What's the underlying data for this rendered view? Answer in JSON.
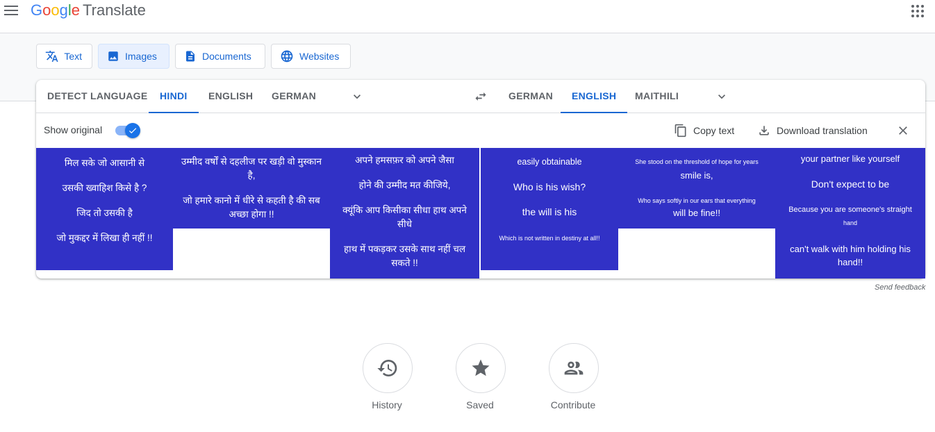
{
  "header": {
    "logo": [
      "G",
      "o",
      "o",
      "g",
      "l",
      "e"
    ],
    "logo_colors": [
      "#4285f4",
      "#ea4335",
      "#fbbc05",
      "#4285f4",
      "#34a853",
      "#ea4335"
    ],
    "product": "Translate"
  },
  "modes": {
    "text": "Text",
    "images": "Images",
    "documents": "Documents",
    "websites": "Websites"
  },
  "source_langs": [
    "DETECT LANGUAGE",
    "HINDI",
    "ENGLISH",
    "GERMAN"
  ],
  "target_langs": [
    "GERMAN",
    "ENGLISH",
    "MAITHILI"
  ],
  "toolbar": {
    "show_original": "Show original",
    "copy_text": "Copy text",
    "download": "Download translation"
  },
  "original": {
    "b1": [
      "मिल सके जो आसानी से",
      "उसकी ख्वाहिश किसे है ?",
      "जिद तो उसकी है",
      "जो मुकद्दर में लिखा ही नहीं !!"
    ],
    "b2": [
      "उम्मीद वर्षों से दहलीज पर खड़ी वो मुस्कान है,",
      "जो हमारे कानो में धीरे से कहती है की सब अच्छा होगा !!"
    ],
    "b3": [
      "अपने हमसफ़र को अपने जैसा",
      "होने की उम्मीद मत कीजिये,",
      "क्यूंकि आप किसीका सीधा हाथ अपने सीधे",
      "हाथ में पकड़कर उसके साथ नहीं चल सकते !!"
    ]
  },
  "translated": {
    "b1": [
      "easily obtainable",
      "Who is his wish?",
      "the will is his",
      "Which is not written in destiny at all!!"
    ],
    "b2": [
      "She stood on the threshold of hope for years",
      "smile is,",
      "Who says softly in our ears that everything",
      "will be fine!!"
    ],
    "b3": [
      "your partner like yourself",
      "Don't expect to be",
      "Because you are someone's straight",
      "hand",
      "can't walk with him holding his hand!!"
    ]
  },
  "feedback": "Send feedback",
  "bottom": {
    "history": "History",
    "saved": "Saved",
    "contribute": "Contribute"
  },
  "colors": {
    "accent": "#1967d2",
    "panel": "#3131c6"
  }
}
